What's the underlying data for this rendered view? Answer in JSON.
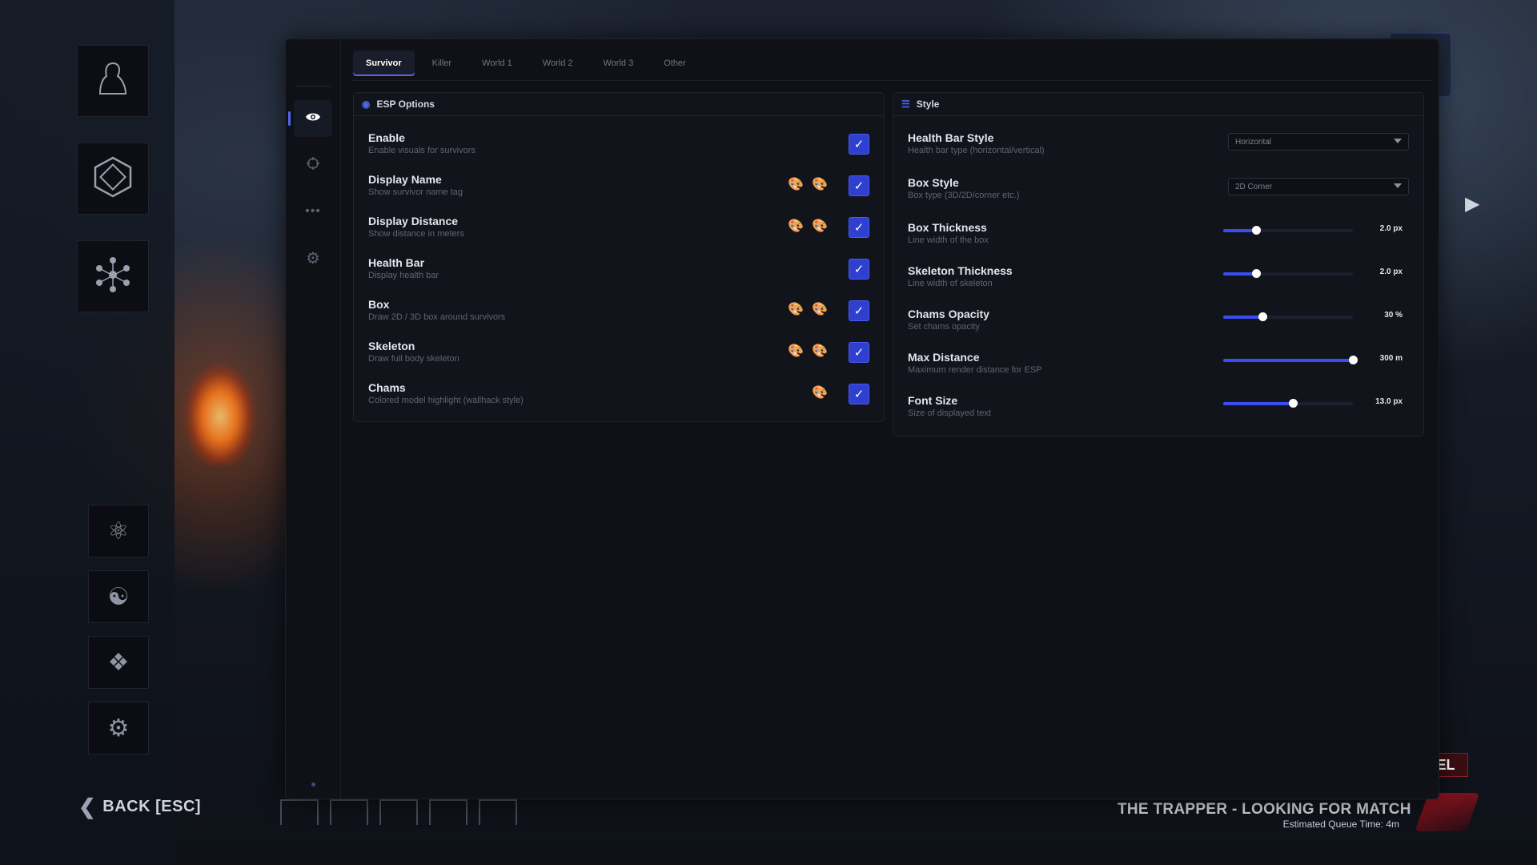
{
  "game": {
    "back_label": "BACK [ESC]",
    "match_title": "THE TRAPPER - LOOKING FOR MATCH",
    "queue_time": "Estimated Queue Time: 4m",
    "badge": "EL"
  },
  "tabs": [
    "Survivor",
    "Killer",
    "World 1",
    "World 2",
    "World 3",
    "Other"
  ],
  "esp": {
    "title": "ESP Options",
    "options": [
      {
        "label": "Enable",
        "desc": "Enable visuals for survivors",
        "checked": true,
        "colors": []
      },
      {
        "label": "Display Name",
        "desc": "Show survivor name tag",
        "checked": true,
        "colors": [
          "#f08a2a",
          "#f08a2a"
        ]
      },
      {
        "label": "Display Distance",
        "desc": "Show distance in meters",
        "checked": true,
        "colors": [
          "#ffffff",
          "#d0d0d0"
        ]
      },
      {
        "label": "Health Bar",
        "desc": "Display health bar",
        "checked": true,
        "colors": []
      },
      {
        "label": "Box",
        "desc": "Draw 2D / 3D box around survivors",
        "checked": true,
        "colors": [
          "#ffffff",
          "#d0d0d0"
        ]
      },
      {
        "label": "Skeleton",
        "desc": "Draw full body skeleton",
        "checked": true,
        "colors": [
          "#ffffff",
          "#d0d0d0"
        ]
      },
      {
        "label": "Chams",
        "desc": "Colored model highlight (wallhack style)",
        "checked": true,
        "colors": [
          "#8a2cf0"
        ]
      }
    ]
  },
  "style": {
    "title": "Style",
    "health_bar_style": {
      "label": "Health Bar Style",
      "desc": "Health bar type (horizontal/vertical)",
      "value": "Horizontal"
    },
    "box_style": {
      "label": "Box Style",
      "desc": "Box type (3D/2D/corner etc.)",
      "value": "2D Corner"
    },
    "sliders": [
      {
        "label": "Box Thickness",
        "desc": "Line width of the box",
        "value_text": "2.0 px",
        "fraction": 0.25
      },
      {
        "label": "Skeleton Thickness",
        "desc": "Line width of skeleton",
        "value_text": "2.0 px",
        "fraction": 0.25
      },
      {
        "label": "Chams Opacity",
        "desc": "Set chams opacity",
        "value_text": "30 %",
        "fraction": 0.3
      },
      {
        "label": "Max Distance",
        "desc": "Maximum render distance for ESP",
        "value_text": "300 m",
        "fraction": 1.0
      },
      {
        "label": "Font Size",
        "desc": "Size of displayed text",
        "value_text": "13.0 px",
        "fraction": 0.54
      }
    ]
  },
  "colors": {
    "accent": "#3a4df0",
    "checkbox": "#2f3fd0"
  }
}
